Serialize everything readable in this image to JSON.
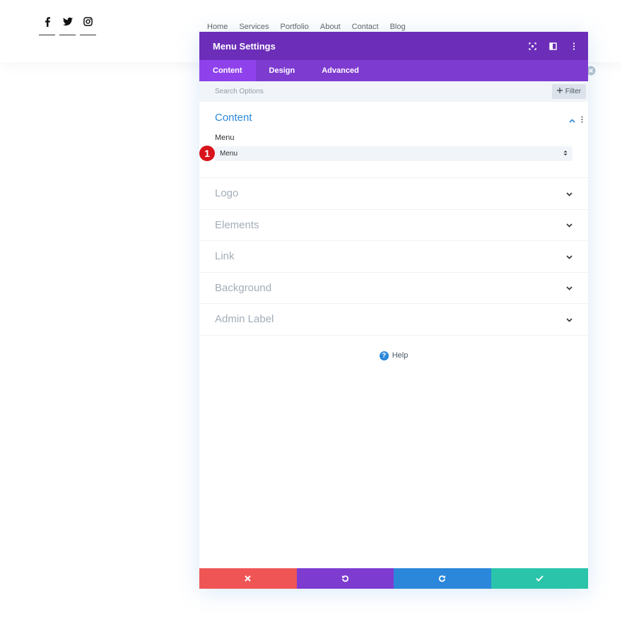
{
  "site": {
    "social": [
      {
        "icon": "facebook-icon"
      },
      {
        "icon": "twitter-icon"
      },
      {
        "icon": "instagram-icon"
      }
    ],
    "nav": [
      "Home",
      "Services",
      "Portfolio",
      "About",
      "Contact",
      "Blog"
    ]
  },
  "modal": {
    "title": "Menu Settings",
    "header_icons": [
      "fullscreen-icon",
      "split-view-icon",
      "more-options-icon"
    ],
    "tabs": [
      {
        "label": "Content",
        "active": true
      },
      {
        "label": "Design",
        "active": false
      },
      {
        "label": "Advanced",
        "active": false
      }
    ],
    "search": {
      "placeholder": "Search Options"
    },
    "filter_label": "Filter",
    "open_section": {
      "title": "Content",
      "field_label": "Menu",
      "select_value": "Menu",
      "badge": "1"
    },
    "sections": [
      "Logo",
      "Elements",
      "Link",
      "Background",
      "Admin Label"
    ],
    "help_label": "Help",
    "footer": [
      "cancel-icon",
      "undo-icon",
      "redo-icon",
      "save-icon"
    ]
  },
  "colors": {
    "header": "#6c2eb9",
    "tabs": "#7e3bd0",
    "active_tab": "#8f42ec",
    "accent": "#2b87da",
    "cancel": "#ef5555",
    "save": "#29c4a9",
    "badge": "#d8131b"
  }
}
